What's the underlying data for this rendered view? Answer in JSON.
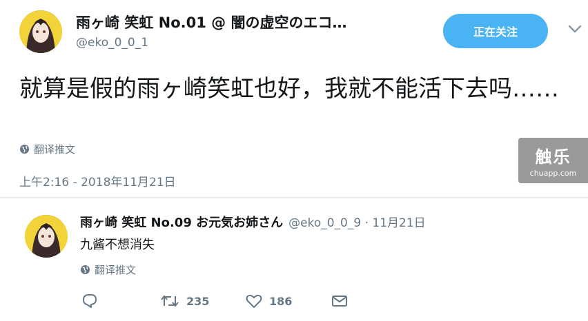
{
  "main_tweet": {
    "display_name": "雨ヶ崎 笑虹 No.01 @ 闇の虚空のエコ…",
    "handle": "@eko_0_0_1",
    "follow_button": "正在关注",
    "text": "就算是假的雨ヶ崎笑虹也好，我就不能活下去吗……",
    "translate_label": "翻译推文",
    "timestamp": "上午2:16 - 2018年11月21日"
  },
  "reply": {
    "display_name": "雨ヶ崎 笑虹 No.09 お元気お姉さん",
    "meta": "@eko_0_0_9 · 11月21日",
    "text": "九酱不想消失",
    "translate_label": "翻译推文",
    "retweet_count": "235",
    "like_count": "186"
  },
  "watermark": {
    "title": "触乐",
    "url": "chuapp.com"
  },
  "colors": {
    "accent": "#4ab3f4",
    "secondary_text": "#657786",
    "avatar_yellow": "#f2d33a"
  },
  "icons": {
    "globe": "globe-icon",
    "chevron": "chevron-down-icon",
    "reply": "reply-icon",
    "retweet": "retweet-icon",
    "like": "heart-icon",
    "dm": "envelope-icon"
  }
}
